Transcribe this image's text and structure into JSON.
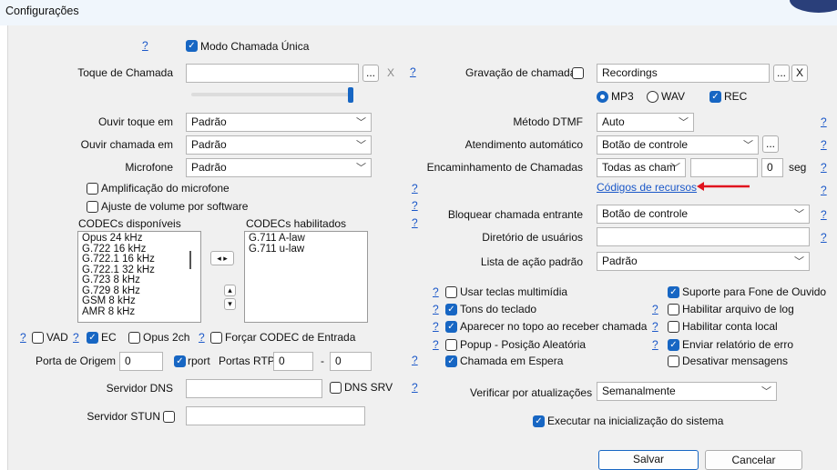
{
  "window": {
    "title": "Configurações"
  },
  "help": "?",
  "left": {
    "single_call": "Modo Chamada Única",
    "ring_label": "Toque de Chamada",
    "ring_value": "",
    "browse": "...",
    "clear": "X",
    "volume_level": 1.0,
    "hear_ring_label": "Ouvir toque em",
    "hear_ring_value": "Padrão",
    "hear_call_label": "Ouvir chamada em",
    "hear_call_value": "Padrão",
    "mic_label": "Microfone",
    "mic_value": "Padrão",
    "mic_amp": "Amplificação do microfone",
    "sw_volume": "Ajuste de volume por software",
    "codecs_available_label": "CODECs disponíveis",
    "codecs_enabled_label": "CODECs habilitados",
    "codecs_available": [
      "Opus 24 kHz",
      "G.722 16 kHz",
      "G.722.1 16 kHz",
      "G.722.1 32 kHz",
      "G.723 8 kHz",
      "G.729 8 kHz",
      "GSM 8 kHz",
      "AMR 8 kHz"
    ],
    "codecs_enabled": [
      "G.711 A-law",
      "G.711 u-law"
    ],
    "move_btn": "◂ ▸",
    "up_btn": "▴",
    "down_btn": "▾",
    "vad": "VAD",
    "ec": "EC",
    "opus2ch": "Opus 2ch",
    "force_codec": "Forçar CODEC de Entrada",
    "src_port_label": "Porta de Origem",
    "src_port_value": "0",
    "rport": "rport",
    "rtp_label": "Portas RTP",
    "rtp_from": "0",
    "rtp_dash": "-",
    "rtp_to": "0",
    "dns_label": "Servidor DNS",
    "dns_value": "",
    "dns_srv": "DNS SRV",
    "stun_label": "Servidor STUN",
    "stun_value": ""
  },
  "right": {
    "rec_label": "Gravação de chamada",
    "rec_path": "Recordings",
    "browse": "...",
    "clear": "X",
    "mp3": "MP3",
    "wav": "WAV",
    "rec": "REC",
    "dtmf_label": "Método DTMF",
    "dtmf_value": "Auto",
    "auto_answer_label": "Atendimento automático",
    "auto_answer_value": "Botão de controle",
    "forward_label": "Encaminhamento de Chamadas",
    "forward_value": "Todas as cham",
    "forward_target": "",
    "forward_delay": "0",
    "forward_unit": "seg",
    "feature_codes": "Códigos de recursos",
    "block_label": "Bloquear chamada entrante",
    "block_value": "Botão de controle",
    "dir_label": "Diretório de usuários",
    "dir_value": "",
    "denylist_label": "Lista de ação padrão",
    "denylist_value": "Padrão"
  },
  "options": {
    "multimedia_keys": "Usar teclas multimídia",
    "key_tones": "Tons do teclado",
    "on_top": "Aparecer no topo ao receber chamada",
    "popup_random": "Popup - Posição Aleatória",
    "call_waiting": "Chamada em Espera",
    "headset": "Suporte para Fone de Ouvido",
    "log_file": "Habilitar arquivo de log",
    "local_account": "Habilitar conta local",
    "error_report": "Enviar relatório de erro",
    "disable_msgs": "Desativar mensagens"
  },
  "updates": {
    "label": "Verificar por atualizações",
    "value": "Semanalmente"
  },
  "startup": "Executar na inicialização do sistema",
  "buttons": {
    "save": "Salvar",
    "cancel": "Cancelar"
  },
  "colors": {
    "accent": "#1766c3",
    "link": "#1a57c8",
    "arrow": "#e0141e"
  }
}
